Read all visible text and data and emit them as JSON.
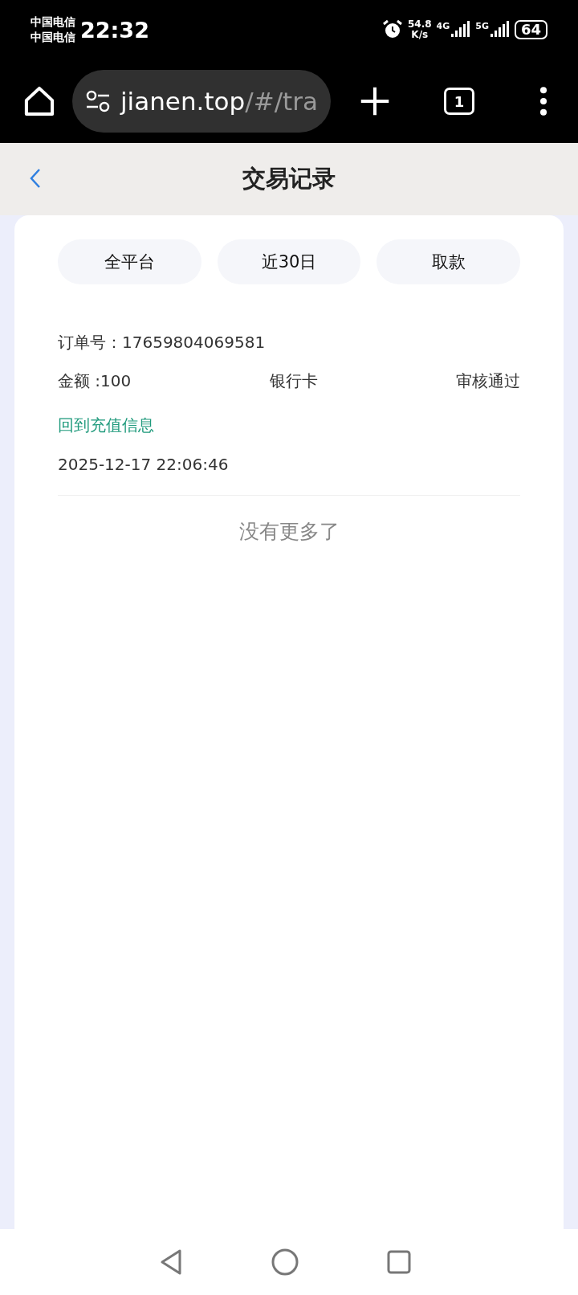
{
  "status_bar": {
    "carriers": [
      "中国电信",
      "中国电信"
    ],
    "time": "22:32",
    "speed": [
      "54.8",
      "K/s"
    ],
    "network_labels": [
      "4G",
      "5G"
    ],
    "battery": "64"
  },
  "browser": {
    "url_host": "jianen.top",
    "url_rest": "/#/tra",
    "tab_count": "1"
  },
  "header": {
    "title": "交易记录"
  },
  "filters": [
    "全平台",
    "近30日",
    "取款"
  ],
  "records": [
    {
      "order_label": "订单号：",
      "order_no": "17659804069581",
      "amount": "金额 :100",
      "method": "银行卡",
      "status": "审核通过",
      "link": "回到充值信息",
      "time": "2025-12-17 22:06:46"
    }
  ],
  "end_text": "没有更多了"
}
